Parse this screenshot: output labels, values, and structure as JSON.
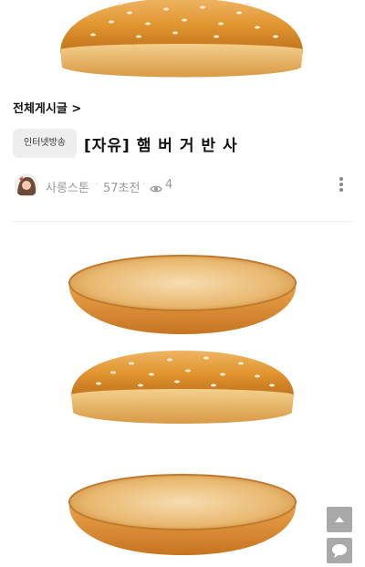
{
  "breadcrumb": {
    "label": "전체게시글 >"
  },
  "post": {
    "board": "인터넷방송",
    "title": "[자유] 햄 버 거 반 사",
    "author": "사롱스톤",
    "time": "57초전",
    "views": "4",
    "separator": "·"
  },
  "icons": {
    "eye": "eye-icon",
    "more": "more-vertical-icon",
    "scroll_top": "caret-up-icon",
    "comment": "speech-bubble-icon"
  },
  "content": {
    "images": [
      "burger-bun-top",
      "burger-bun-bottom",
      "burger-bun-top",
      "burger-bun-bottom"
    ]
  },
  "colors": {
    "bun_crust": "#d9892d",
    "bun_cut": "#e8b56a",
    "side_button": "#a9a9a9",
    "badge_bg": "#eeeeee"
  }
}
